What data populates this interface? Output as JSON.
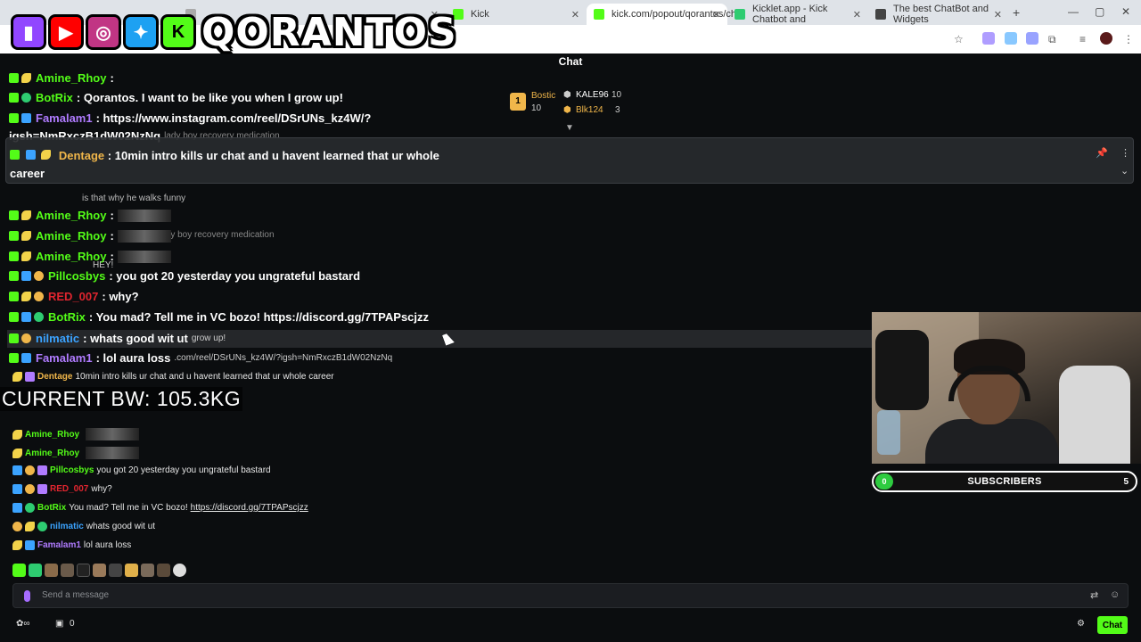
{
  "browser": {
    "tabs": [
      {
        "label": "",
        "active": false
      },
      {
        "label": "Kick",
        "active": false
      },
      {
        "label": "kick.com/popout/qorantos/ch",
        "active": true
      },
      {
        "label": "Kicklet.app - Kick Chatbot and",
        "active": false
      },
      {
        "label": "The best ChatBot and Widgets",
        "active": false
      }
    ],
    "new_tab": "+"
  },
  "overlay": {
    "logo_text": "QORANTOS",
    "bodyweight_text": "CURRENT BW: 105.3KG"
  },
  "chat": {
    "title": "Chat",
    "leaderboard": [
      {
        "rank": "1",
        "name": "Bostic",
        "value": "10"
      },
      {
        "name": "KALE96",
        "value": "10"
      },
      {
        "name": "Blk124",
        "value": "3"
      }
    ],
    "overlay_messages": [
      {
        "user": "Amine_Rhoy",
        "text": ":",
        "color": "#53fc18"
      },
      {
        "user": "BotRix",
        "text": ": Qorantos. I want to be like you when I grow up!",
        "color": "#53fc18"
      },
      {
        "user": "Famalam1",
        "text": ": https://www.instagram.com/reel/DSrUNs_kz4W/?",
        "color": "#b07bff"
      },
      {
        "user": "",
        "text": "igsh=NmRxczB1dW02NzNq",
        "color": "#fff"
      }
    ],
    "pinned": {
      "user": "Dentage",
      "text": ": 10min intro kills ur chat and u havent learned that ur whole",
      "text2": "career"
    },
    "mid_messages": [
      {
        "user": "Amine_Rhoy",
        "text": ":",
        "color": "#53fc18"
      },
      {
        "user": "Amine_Rhoy",
        "text": ":",
        "color": "#53fc18"
      },
      {
        "user": "Pillcosbys",
        "text": ": you got 20 yesterday you ungrateful bastard",
        "color": "#53fc18"
      },
      {
        "user": "RED_007",
        "text": ": why?",
        "color": "#e0252f"
      },
      {
        "user": "BotRix",
        "text": ": You mad? Tell me in VC bozo! https://discord.gg/7TPAPscjzz",
        "color": "#53fc18"
      },
      {
        "user": "nilmatic",
        "text": ": whats good wit ut",
        "color": "#3ba3ff"
      },
      {
        "user": "Famalam1",
        "text": ": lol aura loss",
        "color": "#b07bff"
      }
    ],
    "ghost_text": {
      "lady_boy_1": "lady boy recovery medication",
      "walks": "is that why he walks funny",
      "lady_boy_2": "lady boy recovery medication",
      "grow_up": "grow up!",
      "url": ".com/reel/DSrUNs_kz4W/?igsh=NmRxczB1dW02NzNq",
      "hey": "HEY!"
    },
    "real_messages": [
      {
        "user": "Dentage",
        "text": "10min intro kills ur chat and u havent learned that ur whole career",
        "color": "#f0b64a"
      },
      {
        "user": "Amine_Rhoy",
        "text": "",
        "color": "#53fc18"
      },
      {
        "user": "Amine_Rhoy",
        "text": "",
        "color": "#53fc18"
      },
      {
        "user": "Amine_Rhoy",
        "text": "",
        "color": "#53fc18"
      },
      {
        "user": "Pillcosbys",
        "text": "you got 20 yesterday you ungrateful bastard",
        "color": "#53fc18"
      },
      {
        "user": "RED_007",
        "text": "why?",
        "color": "#e0252f"
      },
      {
        "user": "BotRix",
        "text": "You mad? Tell me in VC bozo!",
        "link": "https://discord.gg/7TPAPscjzz",
        "color": "#53fc18"
      },
      {
        "user": "nilmatic",
        "text": "whats good wit ut",
        "color": "#3ba3ff"
      },
      {
        "user": "Famalam1",
        "text": "lol aura loss",
        "color": "#b07bff"
      }
    ],
    "input_placeholder": "Send a message",
    "footer_count": "0",
    "chat_button": "Chat"
  },
  "subscribers": {
    "label": "SUBSCRIBERS",
    "current": "0",
    "goal": "5"
  }
}
